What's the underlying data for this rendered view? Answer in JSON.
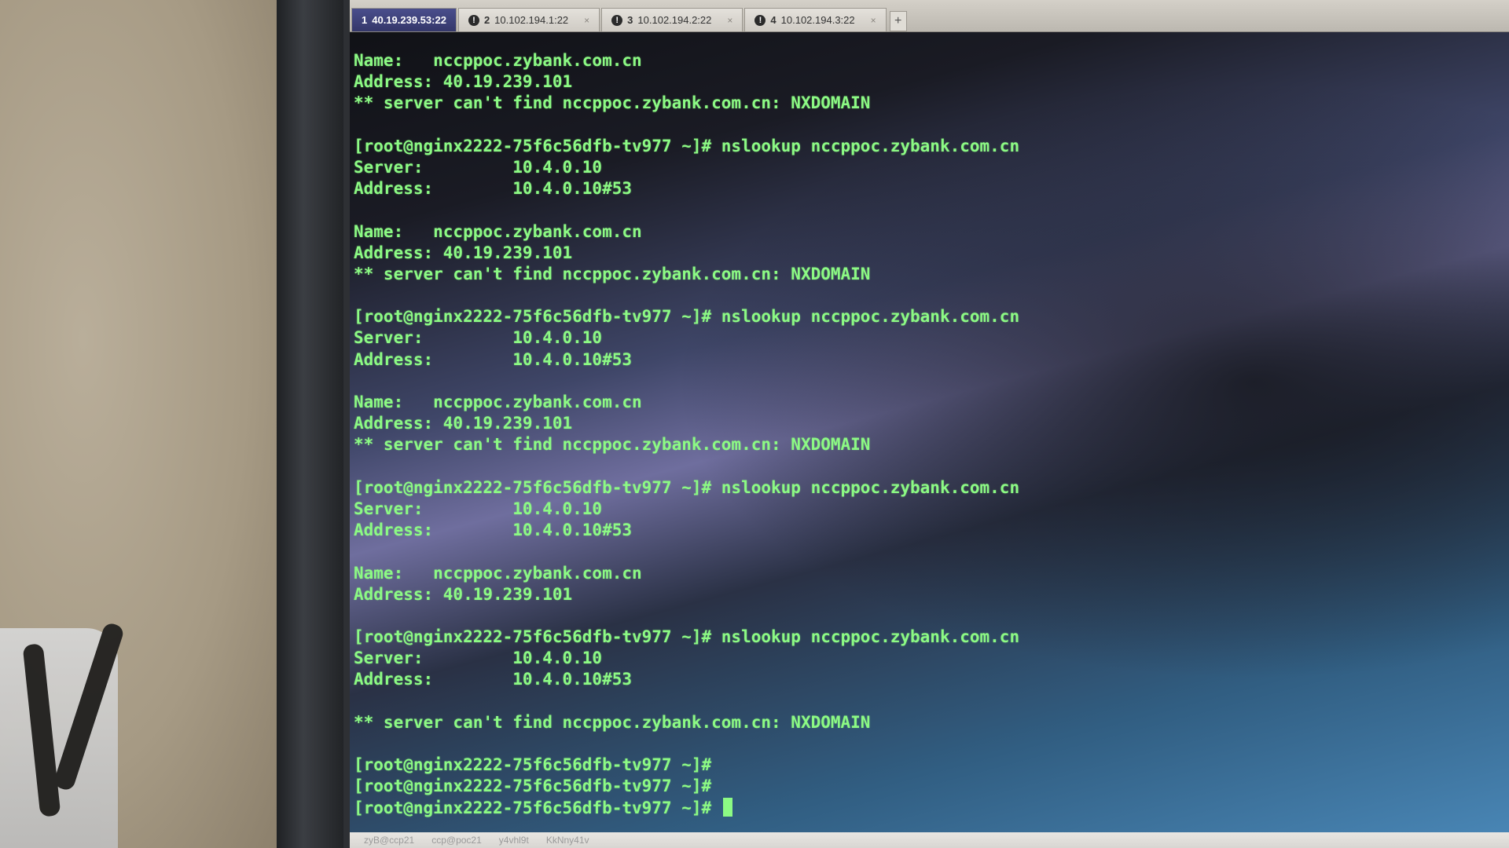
{
  "tabs": [
    {
      "num": "1",
      "label": "40.19.239.53:22",
      "active": true
    },
    {
      "num": "2",
      "label": "10.102.194.1:22",
      "active": false
    },
    {
      "num": "3",
      "label": "10.102.194.2:22",
      "active": false
    },
    {
      "num": "4",
      "label": "10.102.194.3:22",
      "active": false
    }
  ],
  "new_tab_label": "+",
  "terminal_lines": [
    "Name:   nccppoc.zybank.com.cn",
    "Address: 40.19.239.101",
    "** server can't find nccppoc.zybank.com.cn: NXDOMAIN",
    "",
    "[root@nginx2222-75f6c56dfb-tv977 ~]# nslookup nccppoc.zybank.com.cn",
    "Server:         10.4.0.10",
    "Address:        10.4.0.10#53",
    "",
    "Name:   nccppoc.zybank.com.cn",
    "Address: 40.19.239.101",
    "** server can't find nccppoc.zybank.com.cn: NXDOMAIN",
    "",
    "[root@nginx2222-75f6c56dfb-tv977 ~]# nslookup nccppoc.zybank.com.cn",
    "Server:         10.4.0.10",
    "Address:        10.4.0.10#53",
    "",
    "Name:   nccppoc.zybank.com.cn",
    "Address: 40.19.239.101",
    "** server can't find nccppoc.zybank.com.cn: NXDOMAIN",
    "",
    "[root@nginx2222-75f6c56dfb-tv977 ~]# nslookup nccppoc.zybank.com.cn",
    "Server:         10.4.0.10",
    "Address:        10.4.0.10#53",
    "",
    "Name:   nccppoc.zybank.com.cn",
    "Address: 40.19.239.101",
    "",
    "[root@nginx2222-75f6c56dfb-tv977 ~]# nslookup nccppoc.zybank.com.cn",
    "Server:         10.4.0.10",
    "Address:        10.4.0.10#53",
    "",
    "** server can't find nccppoc.zybank.com.cn: NXDOMAIN",
    "",
    "[root@nginx2222-75f6c56dfb-tv977 ~]#",
    "[root@nginx2222-75f6c56dfb-tv977 ~]#"
  ],
  "current_prompt": "[root@nginx2222-75f6c56dfb-tv977 ~]# ",
  "status_items": [
    "zyB@ccp21",
    "ccp@poc21",
    "y4vhl9t",
    "KkNny41v"
  ],
  "colors": {
    "terminal_text": "#8cfa84",
    "active_tab": "#34376a"
  }
}
